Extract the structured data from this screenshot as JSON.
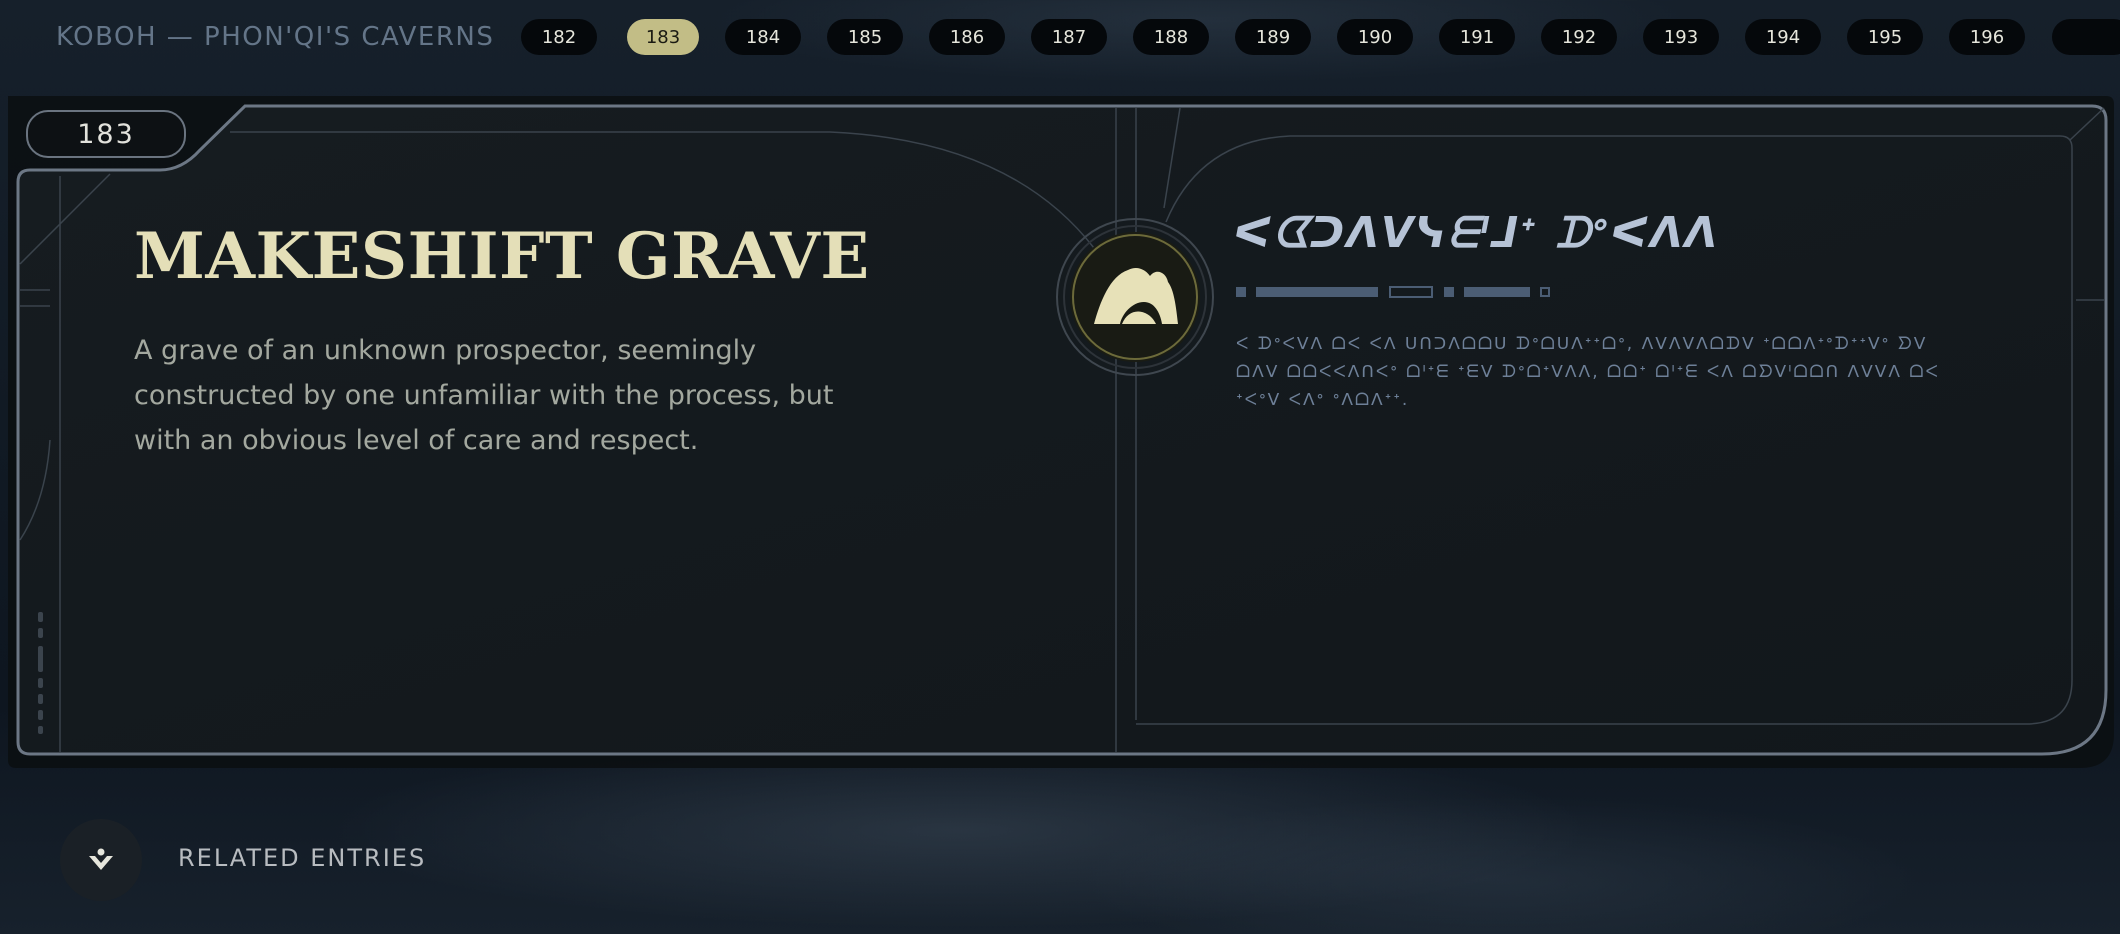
{
  "header": {
    "location": "KOBOH — PHON'QI'S CAVERNS",
    "entries": [
      "182",
      "183",
      "184",
      "185",
      "186",
      "187",
      "188",
      "189",
      "190",
      "191",
      "192",
      "193",
      "194",
      "195",
      "196"
    ],
    "active_entry": "183"
  },
  "entry": {
    "number": "183",
    "title": "MAKESHIFT GRAVE",
    "description": "A grave of an unknown prospector, seemingly constructed by one unfamiliar with the process, but with an obvious level of care and respect.",
    "icon": "grave-icon",
    "aurebesh_title": "ᐸᗧᑐᐱᐯᓭᗴᑊᒧᐩ ᗪᐤᐸᐱᐱ",
    "aurebesh_body": "ᐸ ᗪᐤᐸᐯᐱ ᗝᐸ ᐸᐱ ᑌᑎᑐᐱᗝᗝᑌ ᗪᐤᗝᑌᐱᐩᐩᗝᐤ, ᐱᐯᐱᐯᐱᗝᗪᐯ ᐩᗝᗝᐱᐩᐤᗪᐩᐩᐯᐤ ᗤᐯ ᗝᐱᐯ ᗝᗝᐸᐸᐱᑎᐸᐤ ᗝᑊᐩᗴ ᐩᗴᐯ ᗪᐤᗝᐩᐯᐱᐱ, ᗝᗝᐩ ᗝᑊᐩᗴ ᐸᐱ ᗝᗤᐯᑊᗝᗝᑎ ᐱᐯᐯᐱ ᗝᐸ ᐩᐸᐤᐯ ᐸᐱᐤ ᐤᐱᗝᐱᐩᐩ."
  },
  "footer": {
    "related_label": "RELATED ENTRIES",
    "related_icon": "related-entries-icon"
  },
  "colors": {
    "accent": "#c2bd86",
    "title": "#e4dfb8",
    "frame": "#6a7480",
    "panel_bg": "#141a1f"
  }
}
